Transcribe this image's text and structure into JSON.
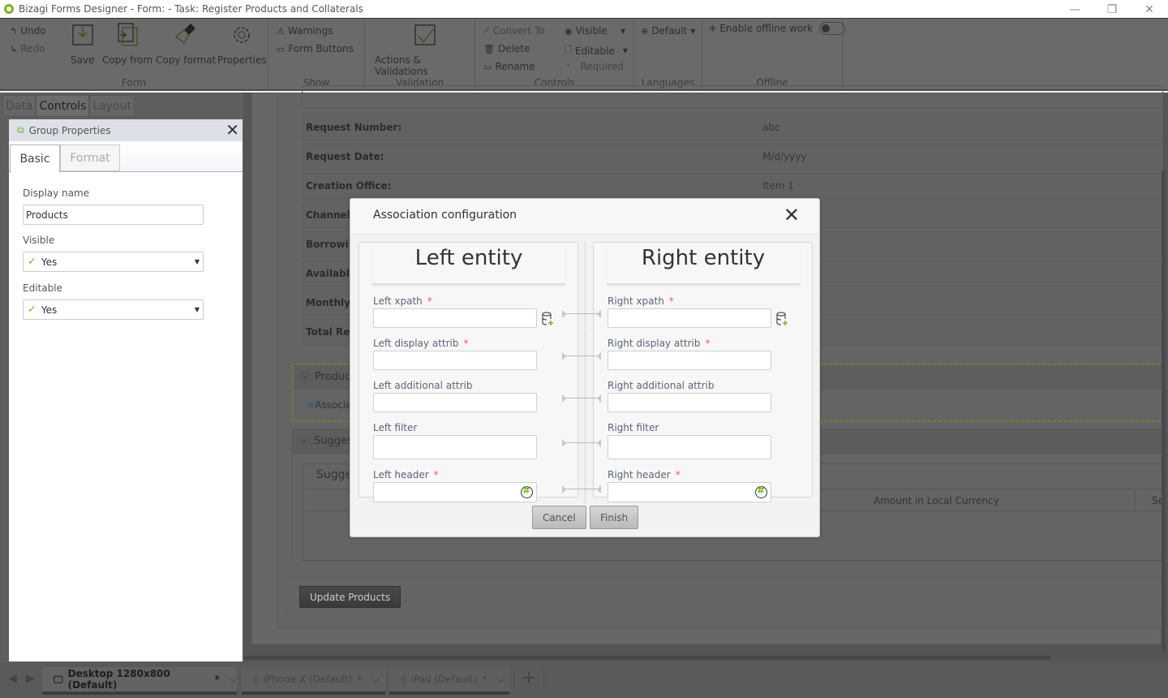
{
  "window": {
    "title": "Bizagi Forms Designer  - Form:  - Task:  Register Products and Collaterals",
    "controls": {
      "minimize": "—",
      "restore": "❐",
      "close": "✕"
    }
  },
  "ribbon": {
    "form": {
      "label": "Form",
      "undo": "Undo",
      "redo": "Redo",
      "save": "Save",
      "copy_from": "Copy from",
      "copy_format": "Copy format",
      "properties": "Properties"
    },
    "show": {
      "label": "Show",
      "warnings": "Warnings",
      "form_buttons": "Form Buttons"
    },
    "validation": {
      "label": "Validation",
      "actions": "Actions & Validations"
    },
    "controls": {
      "label": "Controls",
      "convert_to": "Convert To",
      "delete": "Delete",
      "rename": "Rename",
      "visible": "Visible",
      "editable": "Editable",
      "required": "Required"
    },
    "languages": {
      "label": "Languages",
      "default": "Default"
    },
    "offline": {
      "label": "Offline",
      "enable": "Enable offline work",
      "enabled": false
    }
  },
  "left_panel": {
    "tabs": [
      {
        "label": "Data"
      },
      {
        "label": "Controls",
        "active": true
      },
      {
        "label": "Layout"
      }
    ],
    "group_properties": {
      "title": "Group Properties",
      "tabs": [
        {
          "label": "Basic",
          "active": true
        },
        {
          "label": "Format"
        }
      ],
      "display_name_label": "Display name",
      "display_name_value": "Products",
      "visible_label": "Visible",
      "visible_value": "Yes",
      "editable_label": "Editable",
      "editable_value": "Yes"
    }
  },
  "form": {
    "rows": [
      {
        "label": "Request Number:",
        "value": "abc"
      },
      {
        "label": "Request Date:",
        "value": "M/d/yyyy"
      },
      {
        "label": "Creation Office:",
        "value": "Item 1"
      },
      {
        "label": "Channel:",
        "value": ""
      },
      {
        "label": "Borrowing",
        "value": ""
      },
      {
        "label": "Available",
        "value": ""
      },
      {
        "label": "Monthly F",
        "value": ""
      },
      {
        "label": "Total Requ",
        "value": ""
      }
    ],
    "products_group": {
      "title": "Product",
      "association": "Associa"
    },
    "suggested_group": {
      "title": "Suggest",
      "table_title": "Sugge",
      "columns": [
        "Amount in Local Currency",
        "Se"
      ]
    },
    "update_button": "Update Products"
  },
  "device_tabs": [
    {
      "label": "Desktop 1280x800 (Default)",
      "modified": "*",
      "icon": "monitor-icon",
      "active": true
    },
    {
      "label": "iPhone X (Default)",
      "modified": "*",
      "icon": "phone-icon"
    },
    {
      "label": "iPad (Default)",
      "modified": "*",
      "icon": "tablet-icon"
    }
  ],
  "dialog": {
    "title": "Association configuration",
    "left": {
      "title": "Left entity",
      "fields": [
        {
          "label": "Left xpath",
          "required": true,
          "value": ""
        },
        {
          "label": "Left display attrib",
          "required": true,
          "value": ""
        },
        {
          "label": "Left additional attrib",
          "required": false,
          "value": ""
        },
        {
          "label": "Left filter",
          "required": false,
          "value": ""
        },
        {
          "label": "Left header",
          "required": true,
          "value": ""
        }
      ]
    },
    "right": {
      "title": "Right entity",
      "fields": [
        {
          "label": "Right xpath",
          "required": true,
          "value": ""
        },
        {
          "label": "Right display attrib",
          "required": true,
          "value": ""
        },
        {
          "label": "Right additional attrib",
          "required": false,
          "value": ""
        },
        {
          "label": "Right filter",
          "required": false,
          "value": ""
        },
        {
          "label": "Right header",
          "required": true,
          "value": ""
        }
      ]
    },
    "required_marker": "*",
    "cancel": "Cancel",
    "finish": "Finish"
  }
}
